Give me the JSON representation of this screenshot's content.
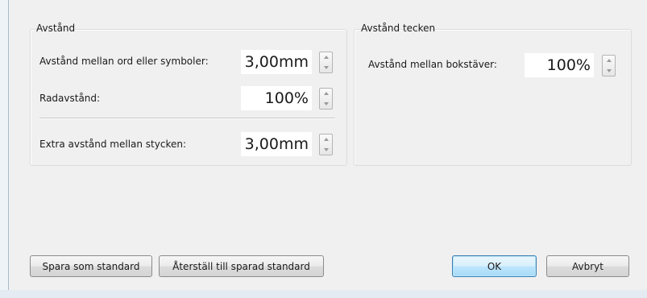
{
  "spacing_group": {
    "title": "Avstånd",
    "word_spacing": {
      "label": "Avstånd mellan ord eller symboler:",
      "value": "3,00mm"
    },
    "line_spacing": {
      "label": "Radavstånd:",
      "value": "100%"
    },
    "paragraph_spacing": {
      "label": "Extra avstånd mellan stycken:",
      "value": "3,00mm"
    }
  },
  "character_group": {
    "title": "Avstånd tecken",
    "letter_spacing": {
      "label": "Avstånd mellan bokstäver:",
      "value": "100%"
    }
  },
  "buttons": {
    "save_default": "Spara som standard",
    "reset_default": "Återställ till sparad standard",
    "ok": "OK",
    "cancel": "Avbryt"
  },
  "icons": {
    "spin_up": "spin-up-arrow-icon",
    "spin_down": "spin-down-arrow-icon"
  }
}
